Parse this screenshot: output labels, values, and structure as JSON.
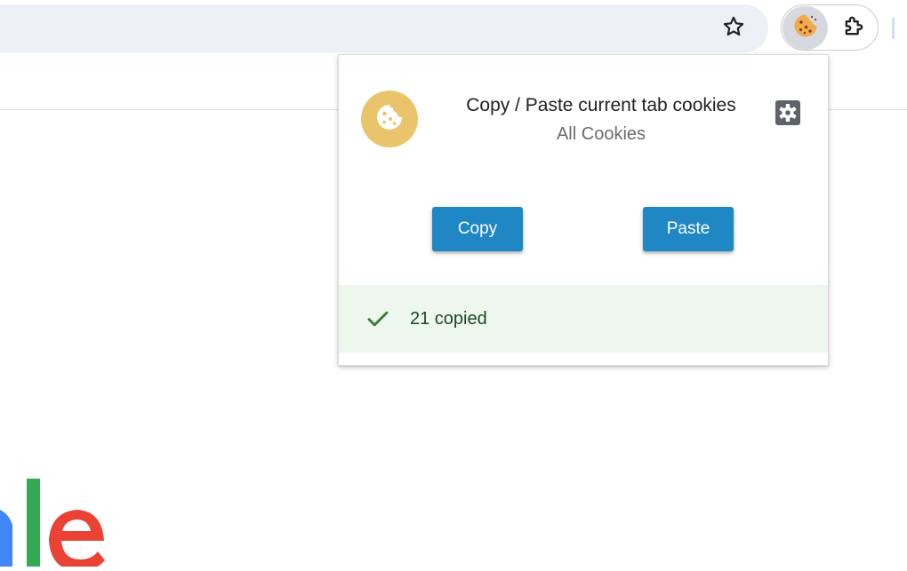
{
  "browser": {
    "bookmark_icon": "star-outline-icon",
    "extensions": [
      {
        "name": "cookie-extension",
        "icon": "cookie-icon",
        "active": true
      },
      {
        "name": "extensions-menu",
        "icon": "puzzle-piece-icon"
      }
    ]
  },
  "popup": {
    "logo_icon": "cookie-icon",
    "title": "Copy / Paste current tab cookies",
    "subtitle": "All Cookies",
    "settings_icon": "gear-icon",
    "copy_label": "Copy",
    "paste_label": "Paste",
    "status": {
      "icon": "check-icon",
      "text": "21 copied"
    }
  },
  "colors": {
    "accent": "#1f87c4",
    "logo_background": "#e9c46a",
    "status_background": "#edf7ed",
    "status_text": "#1e4620",
    "status_icon": "#2e7d32"
  }
}
